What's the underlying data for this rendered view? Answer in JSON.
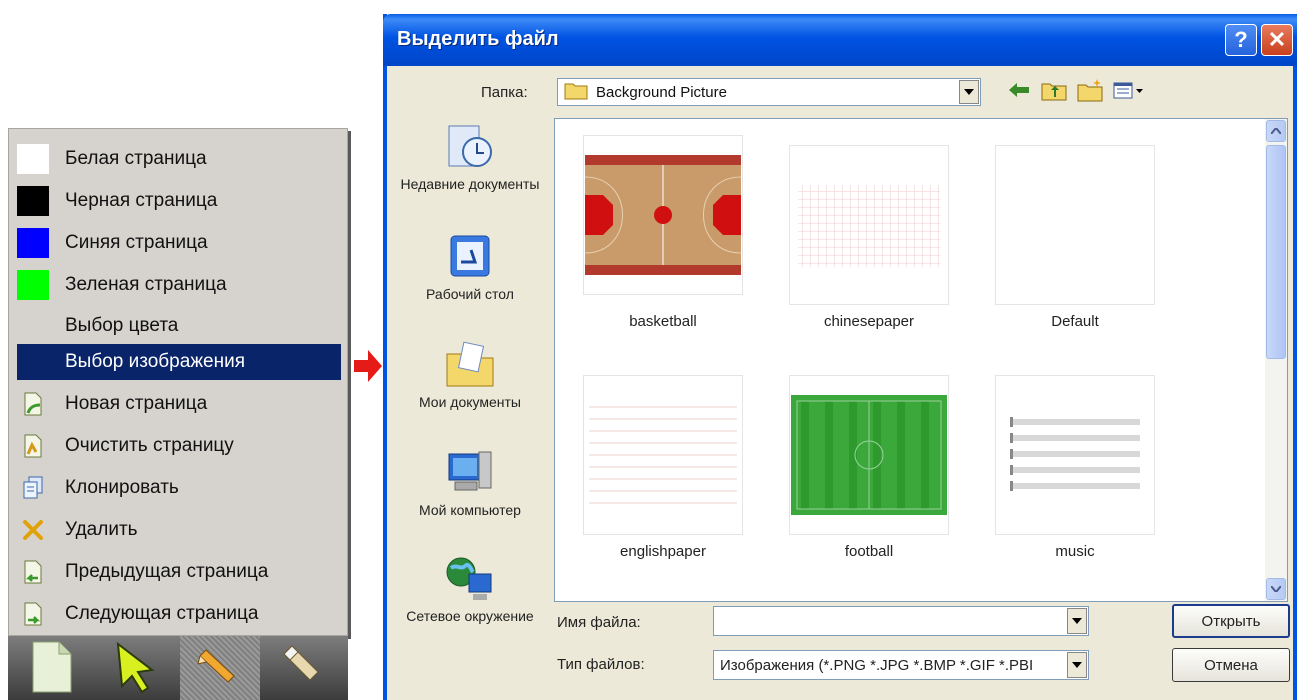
{
  "menu": {
    "items": [
      {
        "label": "Белая страница",
        "lead": "swatch",
        "color": "#ffffff"
      },
      {
        "label": "Черная страница",
        "lead": "swatch",
        "color": "#000000"
      },
      {
        "label": "Синяя страница",
        "lead": "swatch",
        "color": "#0000ff"
      },
      {
        "label": "Зеленая страница",
        "lead": "swatch",
        "color": "#00ff00"
      },
      {
        "label": "Выбор цвета",
        "lead": "none"
      },
      {
        "label": "Выбор изображения",
        "lead": "none",
        "selected": true
      },
      {
        "label": "Новая страница",
        "lead": "icon",
        "icon": "new-page-icon"
      },
      {
        "label": "Очистить страницу",
        "lead": "icon",
        "icon": "clear-page-icon"
      },
      {
        "label": "Клонировать",
        "lead": "icon",
        "icon": "clone-icon"
      },
      {
        "label": "Удалить",
        "lead": "icon",
        "icon": "delete-icon"
      },
      {
        "label": "Предыдущая страница",
        "lead": "icon",
        "icon": "previous-page-icon"
      },
      {
        "label": "Следующая страница",
        "lead": "icon",
        "icon": "next-page-icon"
      }
    ],
    "selected_color": "#0a246a"
  },
  "toolbar": {
    "buttons": [
      "page-icon",
      "pointer-icon",
      "pen-icon",
      "eraser-icon"
    ]
  },
  "dialog": {
    "title": "Выделить файл",
    "help_label": "?",
    "close_label": "✕",
    "lookin_label": "Папка:",
    "lookin_value": "Background Picture",
    "places": [
      "Недавние документы",
      "Рабочий стол",
      "Мои документы",
      "Мой компьютер",
      "Сетевое окружение"
    ],
    "files": [
      "basketball",
      "chinesepaper",
      "Default",
      "englishpaper",
      "football",
      "music"
    ],
    "filename_label": "Имя файла:",
    "filename_value": "",
    "filetype_label": "Тип файлов:",
    "filetype_value": "Изображения (*.PNG *.JPG *.BMP *.GIF *.PBI",
    "open_label": "Открыть",
    "cancel_label": "Отмена"
  }
}
